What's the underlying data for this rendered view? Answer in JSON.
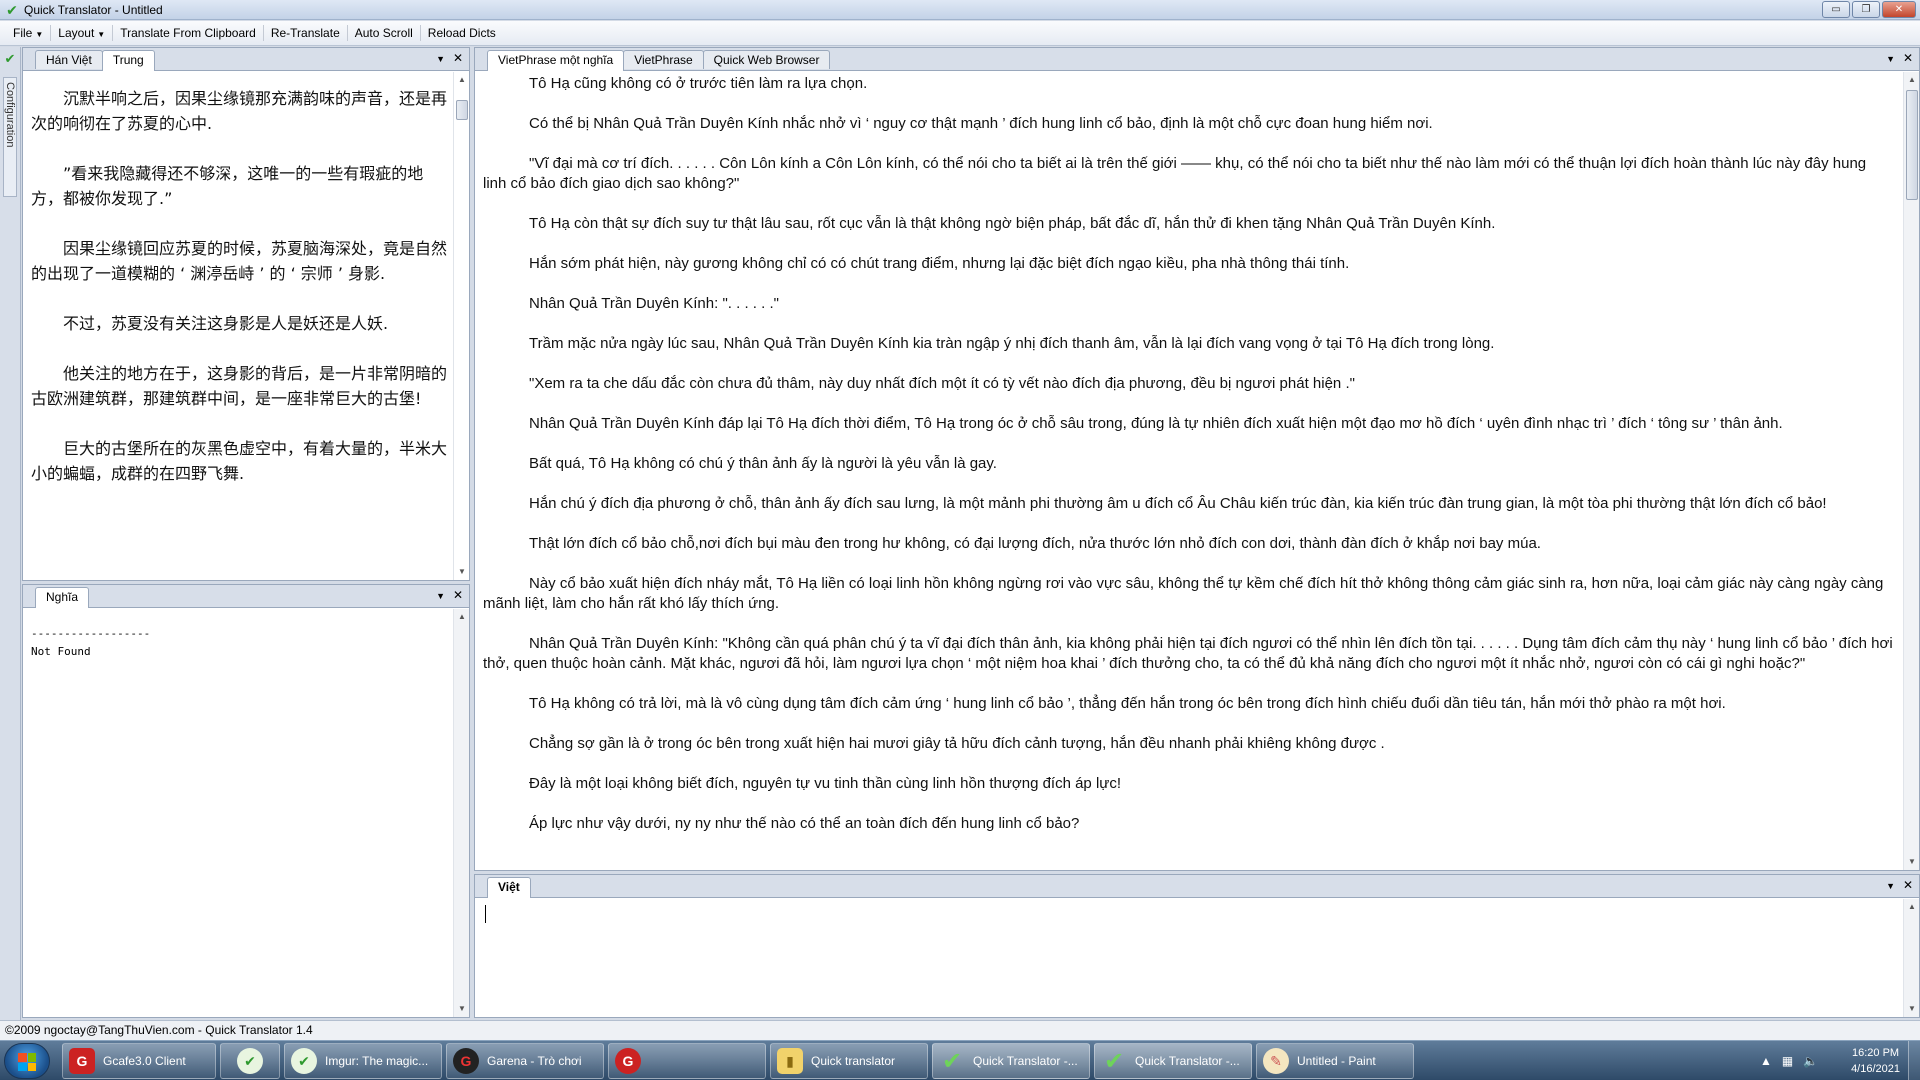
{
  "window": {
    "title": "Quick Translator - Untitled",
    "minimize": "▭",
    "restore": "❐",
    "close": "✕"
  },
  "menu": {
    "file": "File",
    "layout": "Layout",
    "translate_clipboard": "Translate From Clipboard",
    "retranslate": "Re-Translate",
    "auto_scroll": "Auto Scroll",
    "reload_dicts": "Reload Dicts"
  },
  "sidebar": {
    "configuration": "Configuration"
  },
  "left_top_tabs": [
    "Hán Việt",
    "Trung"
  ],
  "chinese_paragraphs": [
    "沉默半响之后，因果尘缘镜那充满韵味的声音，还是再次的响彻在了苏夏的心中.",
    "”看来我隐藏得还不够深，这唯一的一些有瑕疵的地方，都被你发现了.”",
    "因果尘缘镜回应苏夏的时候，苏夏脑海深处，竟是自然的出现了一道模糊的 ‘ 渊渟岳峙 ’ 的 ‘ 宗师 ’ 身影.",
    "不过，苏夏没有关注这身影是人是妖还是人妖.",
    "他关注的地方在于，这身影的背后，是一片非常阴暗的古欧洲建筑群，那建筑群中间，是一座非常巨大的古堡!",
    "巨大的古堡所在的灰黑色虚空中，有着大量的，半米大小的蝙蝠，成群的在四野飞舞."
  ],
  "meaning_panel": {
    "tab": "Nghĩa",
    "divider": "------------------",
    "result": "Not Found"
  },
  "right_top_tabs": [
    "VietPhrase một nghĩa",
    "VietPhrase",
    "Quick Web Browser"
  ],
  "vietnamese_paragraphs": [
    "Tô Hạ cũng không có ở trước tiên làm ra lựa chọn.",
    "Có thể bị Nhân Quả Trần Duyên Kính nhắc nhở vì ‘ nguy cơ thật mạnh ’ đích hung linh cổ bảo, định là một chỗ cực đoan hung hiểm nơi.",
    "\"Vĩ đại mà cơ trí đích. . . . . . Côn Lôn kính a Côn Lôn kính, có thể nói cho ta biết ai là trên thế giới —— khụ, có thể nói cho ta biết như thế nào làm mới có thể thuận lợi đích hoàn thành lúc này đây hung linh cổ bảo đích giao dịch sao không?\"",
    "Tô Hạ còn thật sự đích suy tư thật lâu sau, rốt cục vẫn là thật không ngờ biện pháp, bất đắc dĩ, hắn thử đi khen tặng Nhân Quả Trần Duyên Kính.",
    "Hắn sớm phát hiện, này gương không chỉ có có chút trang điểm, nhưng lại đặc biệt đích ngạo kiều, pha nhà thông thái tính.",
    "Nhân Quả Trần Duyên Kính: \". . . . . .\"",
    "Trầm mặc nửa ngày lúc sau, Nhân Quả Trần Duyên Kính kia tràn ngập ý nhị đích thanh âm, vẫn là lại đích vang vọng ở tại Tô Hạ đích trong lòng.",
    "\"Xem ra ta che dấu đắc còn chưa đủ thâm, này duy nhất đích một ít có tỳ vết nào đích địa phương, đều bị ngươi phát hiện .\"",
    "Nhân Quả Trần Duyên Kính đáp lại Tô Hạ đích thời điểm, Tô Hạ trong óc ở chỗ sâu trong, đúng là tự nhiên đích xuất hiện  một đạo mơ hồ đích ‘ uyên đình nhạc trì ’ đích ‘ tông sư ’ thân ảnh.",
    "Bất quá, Tô Hạ không có chú ý thân ảnh ấy là người là yêu vẫn là gay.",
    "Hắn chú ý đích địa phương ở chỗ, thân ảnh ấy đích sau lưng, là một mảnh phi thường âm u đích cổ Âu Châu kiến trúc đàn, kia kiến trúc đàn trung gian, là một tòa phi thường thật lớn đích cổ bảo!",
    "Thật lớn đích cổ bảo chỗ,nơi đích bụi màu đen trong hư không, có đại lượng đích, nửa thước lớn nhỏ đích con dơi, thành đàn đích ở khắp nơi bay múa.",
    "Này cổ bảo xuất hiện đích nháy mắt, Tô Hạ liền có loại linh hồn không ngừng rơi vào vực sâu, không thể tự kềm chế đích hít thở không thông cảm giác sinh ra, hơn nữa, loại cảm giác này càng ngày càng mãnh liệt, làm cho hắn rất khó lấy thích ứng.",
    "Nhân Quả Trần Duyên Kính: \"Không cần quá phân chú ý ta vĩ đại đích thân ảnh, kia không phải hiện tại đích ngươi có thể nhìn lên đích tồn tại. . . . . . Dụng tâm đích cảm thụ này ‘ hung linh cổ bảo ’ đích hơi thở, quen thuộc hoàn cảnh. Mặt khác, ngươi đã hỏi, làm ngươi lựa chọn ‘ một niệm hoa khai ’ đích thưởng cho, ta có thể đủ khả năng đích cho ngươi một ít nhắc nhở, ngươi còn có cái gì nghi hoặc?\"",
    "Tô Hạ không có trả lời, mà là vô cùng dụng tâm đích cảm ứng ‘ hung linh cổ bảo ’, thẳng đến hắn trong óc bên trong đích hình chiếu đuổi dần tiêu tán, hắn mới thở phào ra một hơi.",
    "Chẳng sợ gần là ở trong óc bên trong xuất hiện  hai mươi giây tả hữu đích cảnh tượng, hắn đều nhanh phải khiêng không được .",
    "Đây là một loại không biết đích, nguyên tự vu tinh thần cùng linh hồn thượng đích áp lực!",
    "Áp lực như vậy dưới, ny ny như thế nào có thể an toàn đích đến hung linh cổ bảo?"
  ],
  "input_panel": {
    "tab": "Việt"
  },
  "statusbar": {
    "text": "©2009 ngoctay@TangThuVien.com - Quick Translator 1.4"
  },
  "taskbar": {
    "items": [
      {
        "label": "Gcafe3.0 Client",
        "icon": "gcafe-icon"
      },
      {
        "label": "",
        "icon": "quick-translator-app-icon"
      },
      {
        "label": "Imgur: The magic...",
        "icon": "imgur-icon"
      },
      {
        "label": "Garena - Trò chơi",
        "icon": "garena-icon"
      },
      {
        "label": "",
        "icon": "garena-plus-icon"
      },
      {
        "label": "Quick translator",
        "icon": "folder-icon"
      },
      {
        "label": "Quick Translator -...",
        "icon": "check-icon"
      },
      {
        "label": "Quick Translator -...",
        "icon": "check-icon"
      },
      {
        "label": "Untitled - Paint",
        "icon": "paint-icon"
      }
    ],
    "time": "16:20 PM",
    "date": "4/16/2021"
  }
}
